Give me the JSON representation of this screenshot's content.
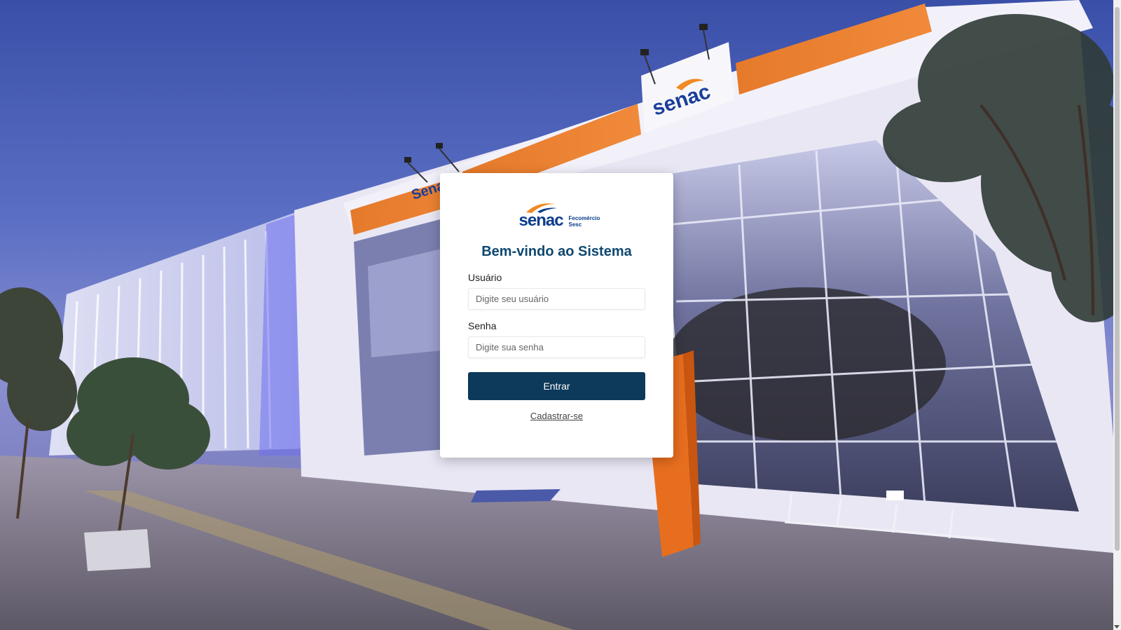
{
  "background": {
    "scene": "building-facade-photo",
    "sign_text": "senac"
  },
  "login": {
    "logo": {
      "brand": "senac",
      "sub_line1": "Fecomércio",
      "sub_line2": "Sesc"
    },
    "title": "Bem-vindo ao Sistema",
    "username": {
      "label": "Usuário",
      "placeholder": "Digite seu usuário",
      "value": ""
    },
    "password": {
      "label": "Senha",
      "placeholder": "Digite sua senha",
      "value": ""
    },
    "submit_label": "Entrar",
    "register_label": "Cadastrar-se"
  },
  "colors": {
    "brand_blue": "#0b3d8c",
    "brand_orange": "#f08a24",
    "title": "#0e4870",
    "button": "#0d3a5a"
  }
}
